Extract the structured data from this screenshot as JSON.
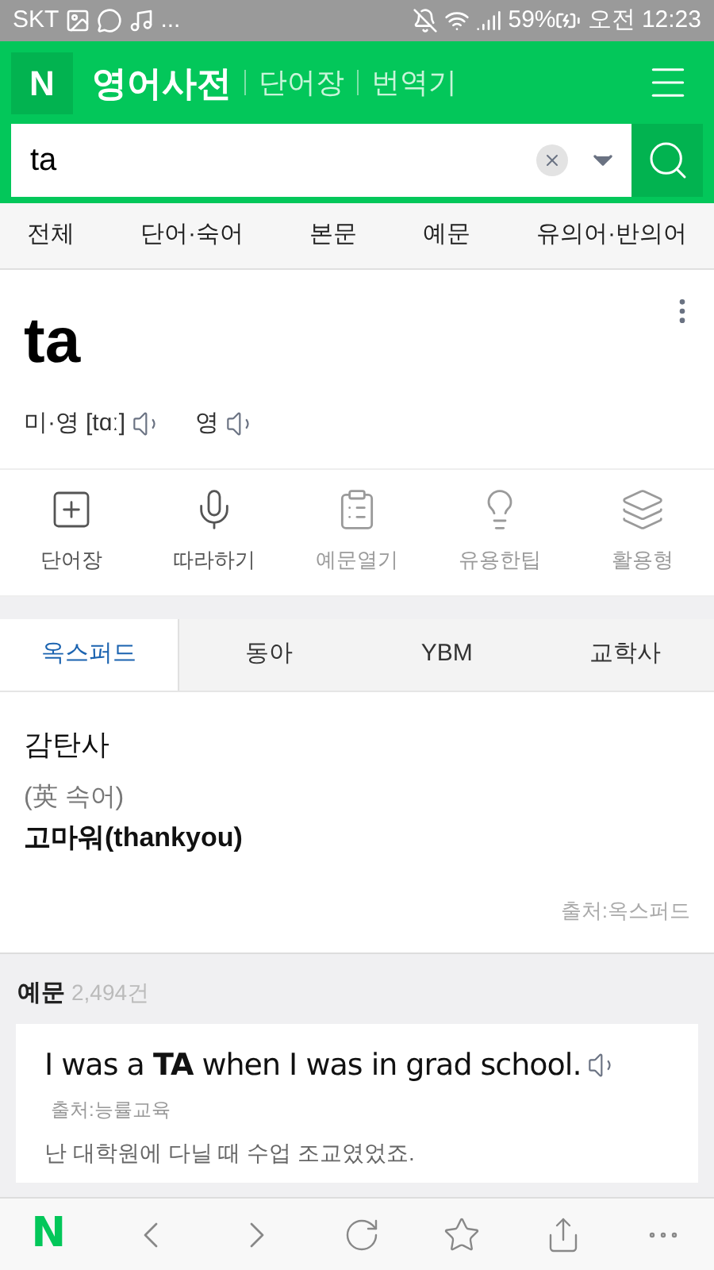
{
  "status_bar": {
    "carrier": "SKT",
    "more": "...",
    "battery": "59%",
    "time": "오전 12:23"
  },
  "header": {
    "logo": "N",
    "title": "영어사전",
    "links": [
      "단어장",
      "번역기"
    ]
  },
  "search": {
    "value": "ta"
  },
  "nav_tabs": [
    {
      "label": "전체"
    },
    {
      "label": "단어·숙어"
    },
    {
      "label": "본문"
    },
    {
      "label": "예문"
    },
    {
      "label": "유의어·반의어"
    }
  ],
  "entry": {
    "word": "ta",
    "pronunciations": [
      {
        "label": "미·영",
        "ipa": "[tɑː]"
      },
      {
        "label": "영"
      }
    ]
  },
  "actions": [
    {
      "label": "단어장",
      "kind": "wordbook",
      "disabled": false
    },
    {
      "label": "따라하기",
      "kind": "mic",
      "disabled": false
    },
    {
      "label": "예문열기",
      "kind": "note",
      "disabled": true
    },
    {
      "label": "유용한팁",
      "kind": "bulb",
      "disabled": true
    },
    {
      "label": "활용형",
      "kind": "stack",
      "disabled": true
    }
  ],
  "dict_tabs": [
    {
      "label": "옥스퍼드",
      "selected": true
    },
    {
      "label": "동아",
      "selected": false
    },
    {
      "label": "YBM",
      "selected": false
    },
    {
      "label": "교학사",
      "selected": false
    }
  ],
  "definition": {
    "part_of_speech": "감탄사",
    "note": "(英 속어)",
    "meaning": "고마워(thankyou)",
    "source": "출처:옥스퍼드"
  },
  "examples": {
    "title": "예문",
    "count": "2,494건",
    "items": [
      {
        "sentence": "I was a **TA** when I was in grad school.",
        "source": "출처:능률교육",
        "translation": "난 대학원에 다닐 때 수업 조교였었죠."
      }
    ]
  },
  "bottom_bar": {
    "logo": "N"
  }
}
